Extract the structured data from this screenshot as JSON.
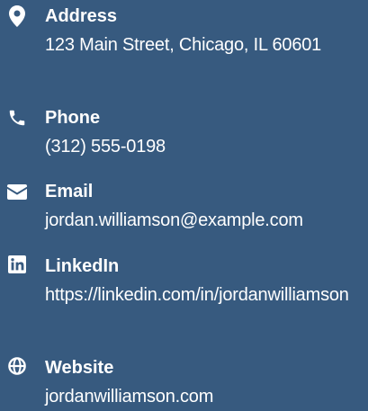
{
  "contact": {
    "address": {
      "icon": "map-pin-icon",
      "label": "Address",
      "value": "123 Main Street, Chicago, IL 60601"
    },
    "phone": {
      "icon": "phone-icon",
      "label": "Phone",
      "value": "(312) 555-0198"
    },
    "email": {
      "icon": "envelope-icon",
      "label": "Email",
      "value": "jordan.williamson@example.com"
    },
    "linkedin": {
      "icon": "linkedin-icon",
      "label": "LinkedIn",
      "value": "https://linkedin.com/in/jordanwilliamson"
    },
    "website": {
      "icon": "globe-icon",
      "label": "Website",
      "value": "jordanwilliamson.com"
    }
  },
  "colors": {
    "background": "#375a7f",
    "text": "#ffffff"
  }
}
